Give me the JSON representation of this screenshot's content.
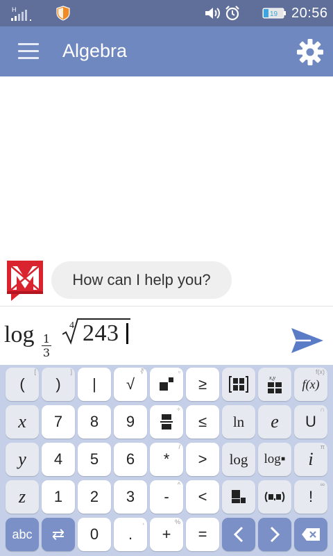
{
  "status_bar": {
    "network_label": "H",
    "battery_level": "19",
    "time": "20:56"
  },
  "app_bar": {
    "title": "Algebra"
  },
  "chat": {
    "bot_message": "How can I help you?"
  },
  "input": {
    "log_text": "log",
    "base_numerator": "1",
    "base_denominator": "3",
    "root_index": "4",
    "radicand": "243"
  },
  "keyboard": {
    "rows": [
      [
        {
          "label": "(",
          "hint": "["
        },
        {
          "label": ")",
          "hint": "]"
        },
        {
          "label": "|",
          "hint": ""
        },
        {
          "label": "√",
          "hint": "∛"
        },
        {
          "label": "▪▪",
          "hint": "▫"
        },
        {
          "label": "≥",
          "hint": ""
        },
        {
          "label": "[▪▪]",
          "hint": ""
        },
        {
          "label": "x,y",
          "hint": ""
        },
        {
          "label": "f(x)",
          "hint": "f(x)"
        }
      ],
      [
        {
          "label": "x",
          "hint": ""
        },
        {
          "label": "7",
          "hint": ""
        },
        {
          "label": "8",
          "hint": ""
        },
        {
          "label": "9",
          "hint": ""
        },
        {
          "label": "▬",
          "hint": "÷"
        },
        {
          "label": "≤",
          "hint": ""
        },
        {
          "label": "ln",
          "hint": ""
        },
        {
          "label": "e",
          "hint": ""
        },
        {
          "label": "U",
          "hint": "∩"
        }
      ],
      [
        {
          "label": "y",
          "hint": ""
        },
        {
          "label": "4",
          "hint": ""
        },
        {
          "label": "5",
          "hint": ""
        },
        {
          "label": "6",
          "hint": ""
        },
        {
          "label": "*",
          "hint": "/"
        },
        {
          "label": ">",
          "hint": ""
        },
        {
          "label": "log",
          "hint": ""
        },
        {
          "label": "log▪",
          "hint": ""
        },
        {
          "label": "i",
          "hint": "π"
        }
      ],
      [
        {
          "label": "z",
          "hint": ""
        },
        {
          "label": "1",
          "hint": ""
        },
        {
          "label": "2",
          "hint": ""
        },
        {
          "label": "3",
          "hint": ""
        },
        {
          "label": "-",
          "hint": "^"
        },
        {
          "label": "<",
          "hint": ""
        },
        {
          "label": "▪▪",
          "hint": ""
        },
        {
          "label": "(▪,▪)",
          "hint": ""
        },
        {
          "label": "!",
          "hint": "∞"
        }
      ],
      [
        {
          "label": "abc",
          "hint": ""
        },
        {
          "label": "⇄",
          "hint": ""
        },
        {
          "label": "0",
          "hint": ""
        },
        {
          "label": ".",
          "hint": ","
        },
        {
          "label": "+",
          "hint": "%"
        },
        {
          "label": "=",
          "hint": ""
        },
        {
          "label": "‹",
          "hint": ""
        },
        {
          "label": "›",
          "hint": ""
        },
        {
          "label": "⌫",
          "hint": ""
        }
      ]
    ]
  },
  "colors": {
    "status_bar": "#5f6f9a",
    "app_bar": "#7088c0",
    "keyboard_bg": "#c5d0e8",
    "accent_blue": "#7a90c6",
    "bot_red": "#d9232e"
  },
  "icons": {
    "menu": "menu-icon",
    "settings": "gear-icon",
    "send": "send-icon",
    "bot": "mathway-logo-icon"
  }
}
